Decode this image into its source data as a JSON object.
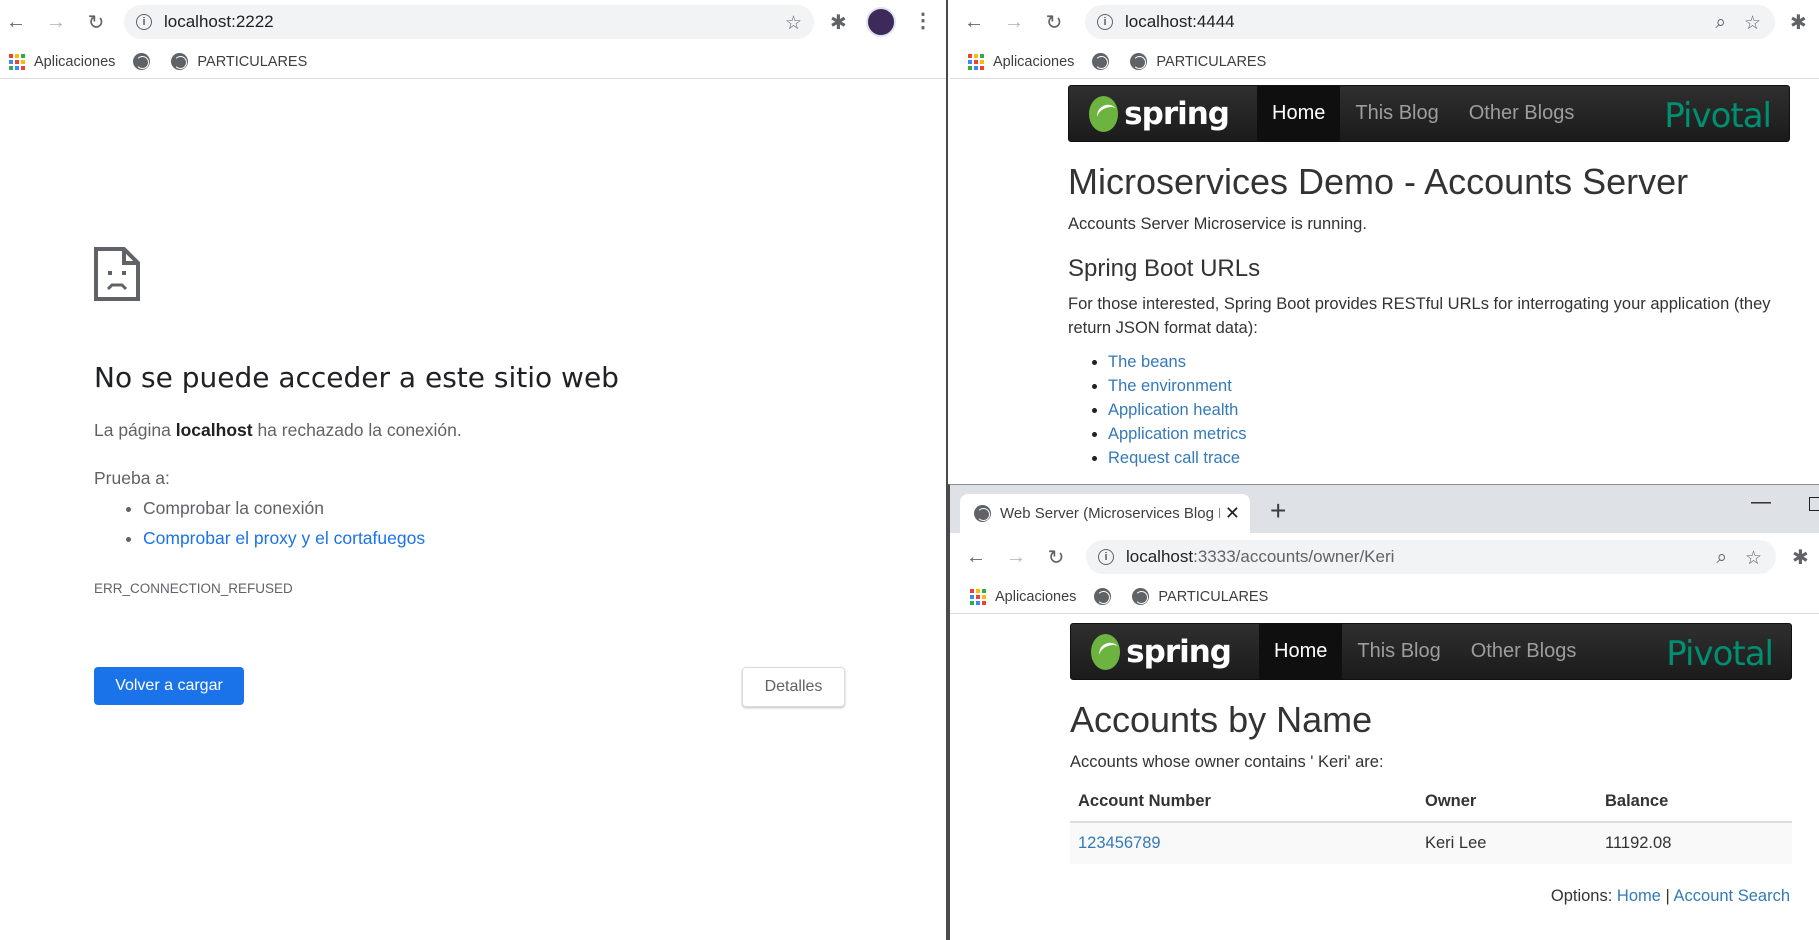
{
  "colors": {
    "chrome_blue": "#1a73e8",
    "spring_green": "#6db33f",
    "pivotal_green": "#008f70",
    "bootstrap_link": "#337ab7",
    "navbar_dark": "#222222"
  },
  "bookmarks": {
    "apps_label": "Aplicaciones",
    "folder_label": "PARTICULARES"
  },
  "left_window": {
    "url": "localhost:2222",
    "error_title": "No se puede acceder a este sitio web",
    "error_text_prefix": "La página ",
    "error_text_host": "localhost",
    "error_text_suffix": " ha rechazado la conexión.",
    "try_label": "Prueba a:",
    "suggestions": [
      "Comprobar la conexión",
      "Comprobar el proxy y el cortafuegos"
    ],
    "error_code": "ERR_CONNECTION_REFUSED",
    "reload_label": "Volver a cargar",
    "details_label": "Detalles"
  },
  "navbar": {
    "brand": "spring",
    "items": [
      "Home",
      "This Blog",
      "Other Blogs"
    ],
    "active": "Home",
    "partner": "Pivotal"
  },
  "top_right_window": {
    "url": "localhost:4444",
    "title": "Microservices Demo - Accounts Server",
    "status": "Accounts Server Microservice is running.",
    "subtitle": "Spring Boot URLs",
    "description": "For those interested, Spring Boot provides RESTful URLs for interrogating your application (they return JSON format data):",
    "links": [
      "The beans",
      "The environment",
      "Application health",
      "Application metrics",
      "Request call trace"
    ]
  },
  "bottom_right_window": {
    "tab_title": "Web Server (Microservices Blog D",
    "url_host": "localhost",
    "url_path": ":3333/accounts/owner/Keri",
    "title": "Accounts by Name",
    "description": "Accounts whose owner contains ' Keri' are:",
    "table": {
      "headers": [
        "Account Number",
        "Owner",
        "Balance"
      ],
      "rows": [
        {
          "number": "123456789",
          "owner": "Keri Lee",
          "balance": "11192.08"
        }
      ]
    },
    "options_label": "Options:",
    "options_links": [
      "Home",
      "Account Search"
    ],
    "options_separator": "|"
  }
}
